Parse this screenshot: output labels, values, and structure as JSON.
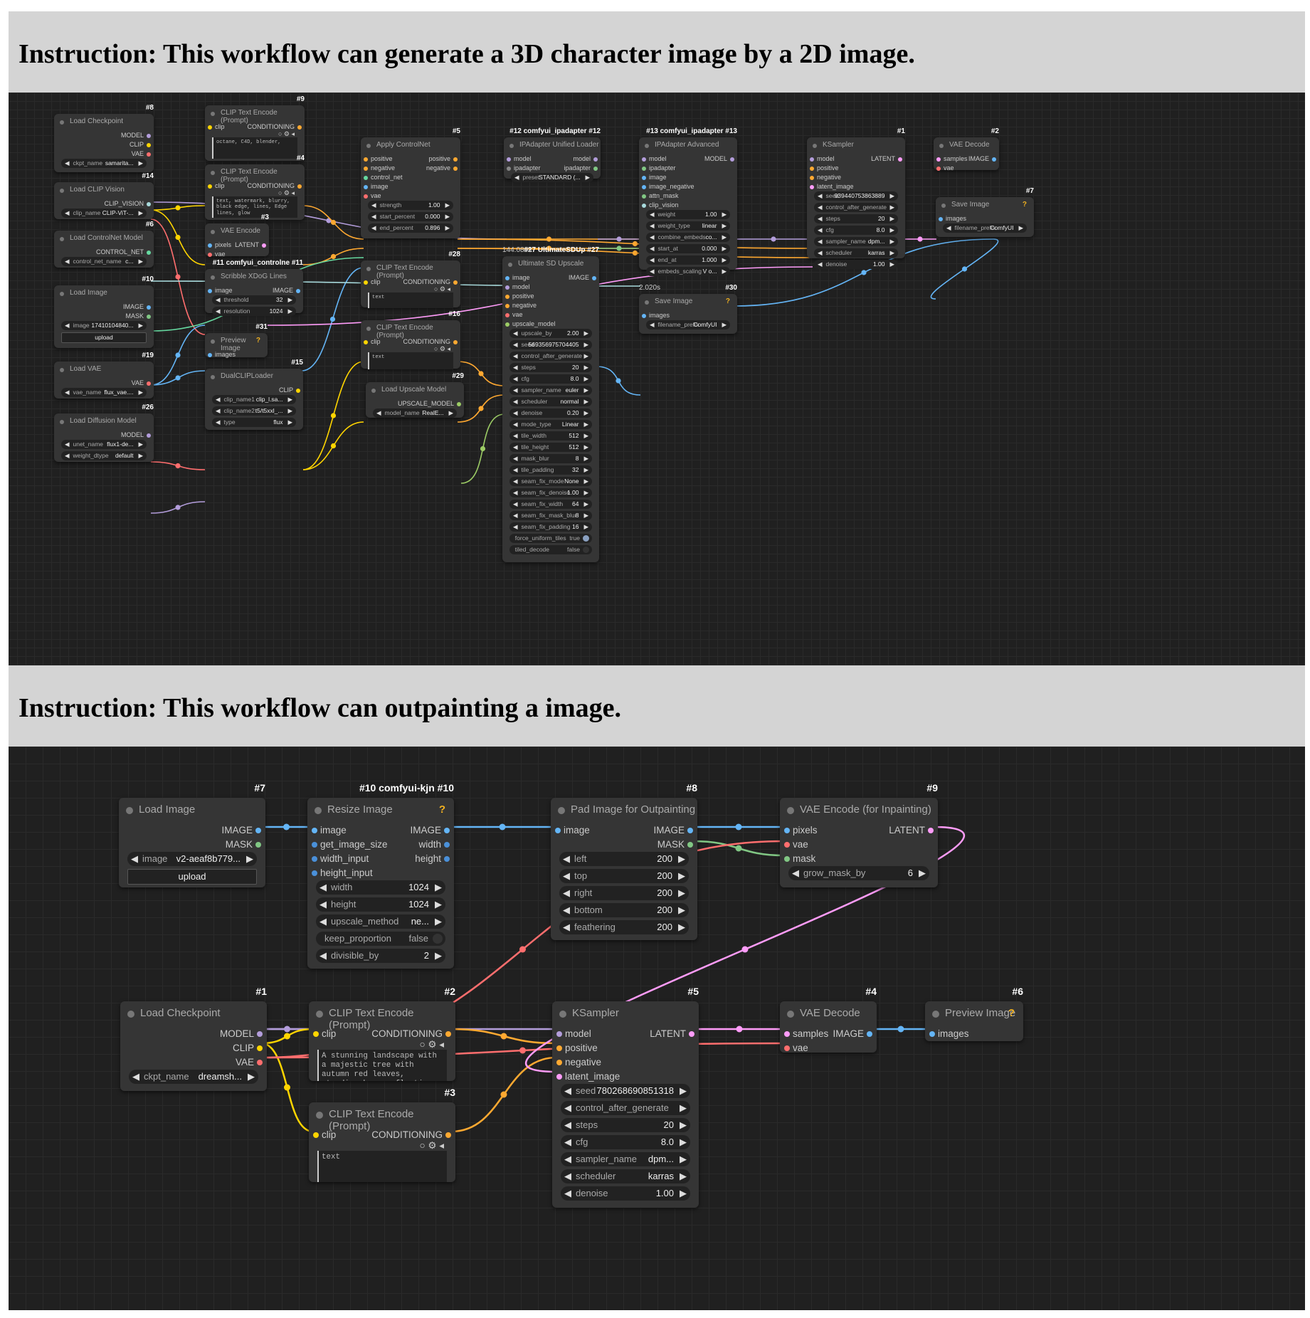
{
  "workflow1": {
    "instruction": "Instruction: This workflow can generate a 3D character image by a 2D image.",
    "nodes": {
      "load_checkpoint": {
        "title": "Load Checkpoint",
        "id": "#8",
        "outputs": [
          "MODEL",
          "CLIP",
          "VAE"
        ],
        "widget_label": "ckpt_name",
        "widget_value": "samarita..."
      },
      "clip_text_9": {
        "title": "CLIP Text Encode (Prompt)",
        "id": "#9",
        "input": "clip",
        "output": "CONDITIONING",
        "text": "octane, C4D, blender,"
      },
      "clip_text_4": {
        "title": "CLIP Text Encode (Prompt)",
        "id": "#4",
        "input": "clip",
        "output": "CONDITIONING",
        "text": "text, watermark, blurry, black edge, lines, Edge lines, glow"
      },
      "load_clip_vision": {
        "title": "Load CLIP Vision",
        "id": "#14",
        "output": "CLIP_VISION",
        "widget_label": "clip_name",
        "widget_value": "CLIP-ViT-..."
      },
      "vae_encode": {
        "title": "VAE Encode",
        "id": "#3",
        "inputs": [
          "pixels",
          "vae"
        ],
        "output": "LATENT"
      },
      "load_controlnet": {
        "title": "Load ControlNet Model",
        "id": "#6",
        "output": "CONTROL_NET",
        "widget_label": "control_net_name",
        "widget_value": "c..."
      },
      "load_image": {
        "title": "Load Image",
        "id": "#10",
        "outputs": [
          "IMAGE",
          "MASK"
        ],
        "widget_label": "image",
        "widget_value": "17410104840...",
        "button": "upload"
      },
      "scribble": {
        "title": "Scribble XDoG Lines",
        "id": "#11 comfyui_controlne #11",
        "input": "image",
        "output": "IMAGE",
        "w1_label": "threshold",
        "w1_value": "32",
        "w2_label": "resolution",
        "w2_value": "1024"
      },
      "preview_image": {
        "title": "Preview Image",
        "id": "#31",
        "input": "images",
        "help": "?"
      },
      "load_vae": {
        "title": "Load VAE",
        "id": "#19",
        "output": "VAE",
        "widget_label": "vae_name",
        "widget_value": "flux_vae...."
      },
      "dual_clip": {
        "title": "DualCLIPLoader",
        "id": "#15",
        "output": "CLIP",
        "w1_label": "clip_name1",
        "w1_value": "clip_l.sa...",
        "w2_label": "clip_name2",
        "w2_value": "t5/t5xxl_...",
        "w3_label": "type",
        "w3_value": "flux"
      },
      "load_diffusion": {
        "title": "Load Diffusion Model",
        "id": "#26",
        "output": "MODEL",
        "w1_label": "unet_name",
        "w1_value": "flux1-de...",
        "w2_label": "weight_dtype",
        "w2_value": "default"
      },
      "apply_controlnet": {
        "title": "Apply ControlNet",
        "id": "#5",
        "inputs": [
          "positive",
          "negative",
          "control_net",
          "image",
          "vae"
        ],
        "outputs": [
          "positive",
          "negative"
        ],
        "widgets": [
          {
            "label": "strength",
            "value": "1.00"
          },
          {
            "label": "start_percent",
            "value": "0.000"
          },
          {
            "label": "end_percent",
            "value": "0.896"
          }
        ]
      },
      "clip_text_28": {
        "title": "CLIP Text Encode (Prompt)",
        "id": "#28",
        "input": "clip",
        "output": "CONDITIONING",
        "text": "text"
      },
      "clip_text_16": {
        "title": "CLIP Text Encode (Prompt)",
        "id": "#16",
        "input": "clip",
        "output": "CONDITIONING",
        "text": "text"
      },
      "load_upscale": {
        "title": "Load Upscale Model",
        "id": "#29",
        "output": "UPSCALE_MODEL",
        "widget_label": "model_name",
        "widget_value": "RealE..."
      },
      "ipadapter_loader": {
        "title": "IPAdapter Unified Loader",
        "id": "#12 comfyui_ipadapter #12",
        "inputs": [
          "model",
          "ipadapter"
        ],
        "outputs": [
          "model",
          "ipadapter"
        ],
        "widget_label": "preset",
        "widget_value": "STANDARD (..."
      },
      "ultimate_sd": {
        "title": "Ultimate SD Upscale",
        "id": "#27 UltimateSDUp #27",
        "time": "144.080s",
        "inputs": [
          "image",
          "model",
          "positive",
          "negative",
          "vae",
          "upscale_model"
        ],
        "output": "IMAGE",
        "widgets": [
          {
            "label": "upscale_by",
            "value": "2.00"
          },
          {
            "label": "seed",
            "value": "569356975704405"
          },
          {
            "label": "control_after_generate",
            "value": ""
          },
          {
            "label": "steps",
            "value": "20"
          },
          {
            "label": "cfg",
            "value": "8.0"
          },
          {
            "label": "sampler_name",
            "value": "euler"
          },
          {
            "label": "scheduler",
            "value": "normal"
          },
          {
            "label": "denoise",
            "value": "0.20"
          },
          {
            "label": "mode_type",
            "value": "Linear"
          },
          {
            "label": "tile_width",
            "value": "512"
          },
          {
            "label": "tile_height",
            "value": "512"
          },
          {
            "label": "mask_blur",
            "value": "8"
          },
          {
            "label": "tile_padding",
            "value": "32"
          },
          {
            "label": "seam_fix_mode",
            "value": "None"
          },
          {
            "label": "seam_fix_denoise",
            "value": "1.00"
          },
          {
            "label": "seam_fix_width",
            "value": "64"
          },
          {
            "label": "seam_fix_mask_blur",
            "value": "8"
          },
          {
            "label": "seam_fix_padding",
            "value": "16"
          }
        ],
        "toggles": [
          {
            "label": "force_uniform_tiles",
            "value": "true"
          },
          {
            "label": "tiled_decode",
            "value": "false"
          }
        ]
      },
      "ipadapter_adv": {
        "title": "IPAdapter Advanced",
        "id": "#13 comfyui_ipadapter #13",
        "inputs": [
          "model",
          "ipadapter",
          "image",
          "image_negative",
          "attn_mask",
          "clip_vision"
        ],
        "output": "MODEL",
        "widgets": [
          {
            "label": "weight",
            "value": "1.00"
          },
          {
            "label": "weight_type",
            "value": "linear"
          },
          {
            "label": "combine_embeds",
            "value": "co..."
          },
          {
            "label": "start_at",
            "value": "0.000"
          },
          {
            "label": "end_at",
            "value": "1.000"
          },
          {
            "label": "embeds_scaling",
            "value": "V o..."
          }
        ]
      },
      "save_image_30": {
        "title": "Save Image",
        "id": "#30",
        "time": "2.020s",
        "input": "images",
        "widget_label": "filename_prefix",
        "widget_value": "ComfyUI",
        "help": "?"
      },
      "ksampler": {
        "title": "KSampler",
        "id": "#1",
        "inputs": [
          "model",
          "positive",
          "negative",
          "latent_image"
        ],
        "output": "LATENT",
        "widgets": [
          {
            "label": "seed",
            "value": "939440753863889"
          },
          {
            "label": "control_after_generate",
            "value": ""
          },
          {
            "label": "steps",
            "value": "20"
          },
          {
            "label": "cfg",
            "value": "8.0"
          },
          {
            "label": "sampler_name",
            "value": "dpm..."
          },
          {
            "label": "scheduler",
            "value": "karras"
          },
          {
            "label": "denoise",
            "value": "1.00"
          }
        ]
      },
      "vae_decode": {
        "title": "VAE Decode",
        "id": "#2",
        "inputs": [
          "samples",
          "vae"
        ],
        "output": "IMAGE"
      },
      "save_image_7": {
        "title": "Save Image",
        "id": "#7",
        "input": "images",
        "widget_label": "filename_prefix",
        "widget_value": "ComfyUI",
        "help": "?"
      }
    }
  },
  "workflow2": {
    "instruction": "Instruction: This workflow can outpainting a image.",
    "nodes": {
      "load_image": {
        "title": "Load Image",
        "id": "#7",
        "outputs": [
          "IMAGE",
          "MASK"
        ],
        "widget_label": "image",
        "widget_value": "v2-aeaf8b779...",
        "button": "upload"
      },
      "resize_image": {
        "title": "Resize Image",
        "id": "#10 comfyui-kjn #10",
        "help": "?",
        "inputs": [
          "image",
          "get_image_size",
          "width_input",
          "height_input"
        ],
        "outputs": [
          "IMAGE",
          "width",
          "height"
        ],
        "widgets": [
          {
            "label": "width",
            "value": "1024"
          },
          {
            "label": "height",
            "value": "1024"
          },
          {
            "label": "upscale_method",
            "value": "ne..."
          }
        ],
        "toggle": {
          "label": "keep_proportion",
          "value": "false"
        },
        "last": {
          "label": "divisible_by",
          "value": "2"
        }
      },
      "pad_image": {
        "title": "Pad Image for Outpainting",
        "id": "#8",
        "input": "image",
        "outputs": [
          "IMAGE",
          "MASK"
        ],
        "widgets": [
          {
            "label": "left",
            "value": "200"
          },
          {
            "label": "top",
            "value": "200"
          },
          {
            "label": "right",
            "value": "200"
          },
          {
            "label": "bottom",
            "value": "200"
          },
          {
            "label": "feathering",
            "value": "200"
          }
        ]
      },
      "vae_encode_inpaint": {
        "title": "VAE Encode (for Inpainting)",
        "id": "#9",
        "inputs": [
          "pixels",
          "vae",
          "mask"
        ],
        "output": "LATENT",
        "widget_label": "grow_mask_by",
        "widget_value": "6"
      },
      "load_checkpoint": {
        "title": "Load Checkpoint",
        "id": "#1",
        "outputs": [
          "MODEL",
          "CLIP",
          "VAE"
        ],
        "widget_label": "ckpt_name",
        "widget_value": "dreamsh..."
      },
      "clip_text_2": {
        "title": "CLIP Text Encode (Prompt)",
        "id": "#2",
        "input": "clip",
        "output": "CONDITIONING",
        "text": "A stunning landscape with a majestic tree with autumn red leaves, standing by a reflective river. The"
      },
      "clip_text_3": {
        "title": "CLIP Text Encode (Prompt)",
        "id": "#3",
        "input": "clip",
        "output": "CONDITIONING",
        "text": "text"
      },
      "ksampler": {
        "title": "KSampler",
        "id": "#5",
        "inputs": [
          "model",
          "positive",
          "negative",
          "latent_image"
        ],
        "output": "LATENT",
        "widgets": [
          {
            "label": "seed",
            "value": "780268690851318"
          },
          {
            "label": "control_after_generate",
            "value": ""
          },
          {
            "label": "steps",
            "value": "20"
          },
          {
            "label": "cfg",
            "value": "8.0"
          },
          {
            "label": "sampler_name",
            "value": "dpm..."
          },
          {
            "label": "scheduler",
            "value": "karras"
          },
          {
            "label": "denoise",
            "value": "1.00"
          }
        ]
      },
      "vae_decode": {
        "title": "VAE Decode",
        "id": "#4",
        "inputs": [
          "samples",
          "vae"
        ],
        "output": "IMAGE"
      },
      "preview_image": {
        "title": "Preview Image",
        "id": "#6",
        "input": "images",
        "help": "?"
      }
    }
  },
  "colors": {
    "model": "#b39ddb",
    "clip": "#ffd500",
    "vae": "#ff6e6e",
    "conditioning": "#ffa931",
    "image": "#64b5f6",
    "latent": "#ff9cf9",
    "mask": "#81c784",
    "control_net": "#66d9a0",
    "clip_vision": "#a8dadc",
    "upscale_model": "#9ccc65",
    "int": "#4a90d9"
  }
}
